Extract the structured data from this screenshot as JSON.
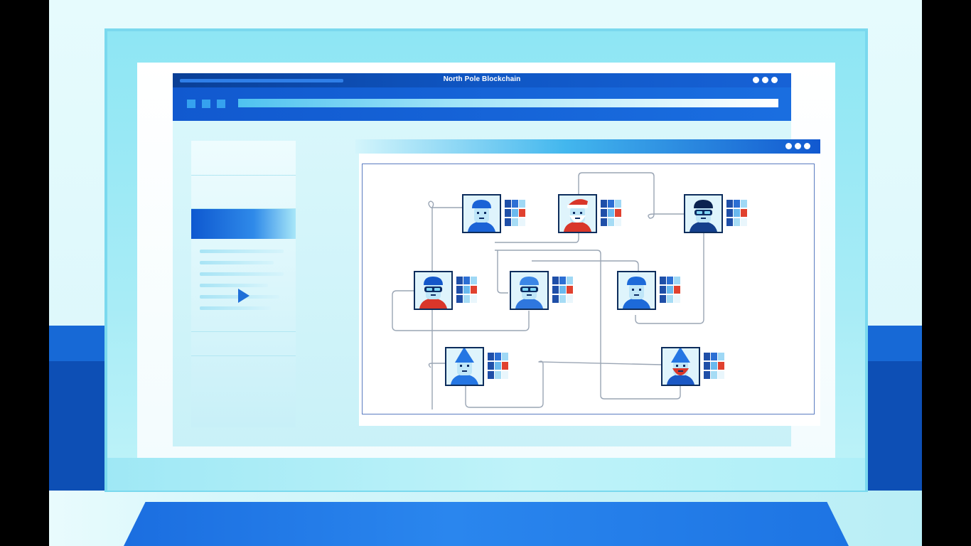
{
  "window": {
    "title": "North Pole Blockchain"
  },
  "colors": {
    "brand_dark": "#0a3f96",
    "brand": "#1762d6",
    "accent_light": "#8ee6f4",
    "santa_red": "#d9362a",
    "block_blue": "#1f4fa8"
  },
  "sidebar": {
    "items": [
      "empty",
      "empty",
      "selected",
      "list",
      "empty"
    ]
  },
  "network": {
    "nodes": [
      {
        "id": "elf-blue-cap",
        "icon": "elf-avatar-icon"
      },
      {
        "id": "santa",
        "icon": "santa-avatar-icon"
      },
      {
        "id": "elf-dark-hair",
        "icon": "elf-avatar-icon"
      },
      {
        "id": "elf-goggles-red",
        "icon": "elf-avatar-icon"
      },
      {
        "id": "elf-goggles-blue",
        "icon": "elf-avatar-icon"
      },
      {
        "id": "elf-blue-hair",
        "icon": "elf-avatar-icon"
      },
      {
        "id": "gnome-blue",
        "icon": "gnome-avatar-icon"
      },
      {
        "id": "gnome-red-beard",
        "icon": "gnome-avatar-icon"
      }
    ]
  }
}
